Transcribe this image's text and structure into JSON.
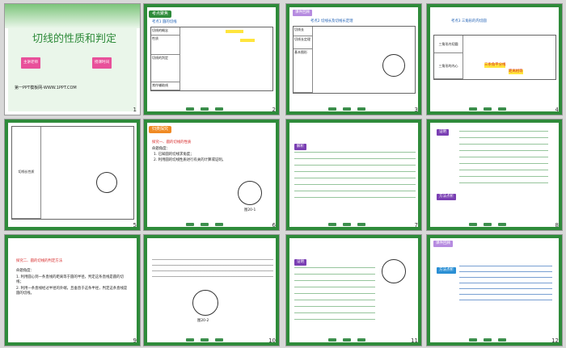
{
  "slides": [
    {
      "n": "1",
      "title": "切线的性质和判定",
      "footer": "第一PPT模板网-WWW.1PPT.COM",
      "btn1": "主讲老师",
      "btn2": "授课时间"
    },
    {
      "n": "2",
      "header": "考点聚焦",
      "sub": "考点1  圆的切线",
      "rows": [
        "切线的概念",
        "性质",
        "切线的判定",
        "常作辅助线"
      ]
    },
    {
      "n": "3",
      "header": "课件回顾",
      "sub": "考点2  切线长及切线长定理",
      "rows": [
        "切线长",
        "切线长定理",
        "基本图形"
      ]
    },
    {
      "n": "4",
      "sub": "考点3  三角形的内切圆",
      "rows": [
        "三角形内切圆",
        "三角形的内心"
      ],
      "highlight1": "三条角平分线",
      "highlight2": "距离相等"
    },
    {
      "n": "5",
      "row": "切线长性质"
    },
    {
      "n": "6",
      "header": "归类探究",
      "sub": "探究一、圆的切线的性质",
      "p1": "命题角度：",
      "p2": "1. 已知圆的切线求角度；",
      "p3": "2. 利用圆的切线性质进行有关的计算或证明。",
      "fig": "图20-1"
    },
    {
      "n": "7",
      "label": "解析"
    },
    {
      "n": "8",
      "label1": "证明",
      "label2": "方法点析"
    },
    {
      "n": "9",
      "title": "探究二、圆的切线的判定方法",
      "p1": "命题角度：",
      "p2": "1. 利用圆心到一条直线的距离等于圆的半径，判定这条直线是圆的切线；",
      "p3": "2. 利用一条直线经过半径的外端，且垂直于这条半径，判定这条直线是圆的切线。"
    },
    {
      "n": "10",
      "fig": "图20-2"
    },
    {
      "n": "11",
      "label": "证明"
    },
    {
      "n": "12",
      "header": "课件回顾",
      "label": "方法点析"
    }
  ]
}
